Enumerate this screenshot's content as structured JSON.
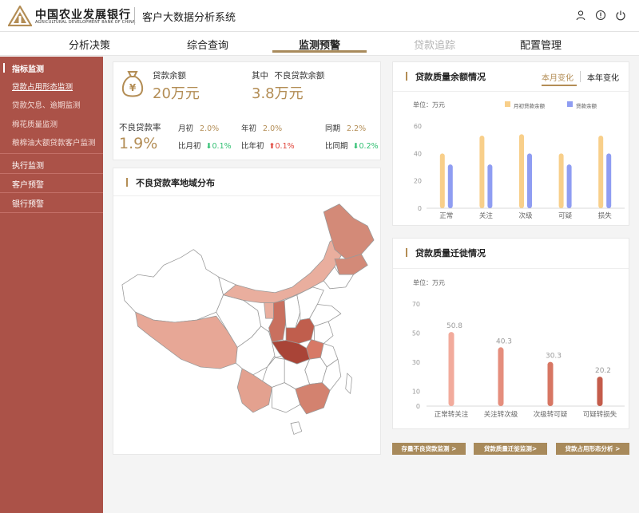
{
  "header": {
    "brand_cn": "中国农业发展银行",
    "brand_en": "AGRICULTURAL DEVELOPMENT BANK OF CHINA",
    "system_title": "客户大数据分析系统",
    "icons": [
      "user-icon",
      "info-icon",
      "power-icon"
    ]
  },
  "nav": {
    "items": [
      {
        "label": "分析决策",
        "state": "normal"
      },
      {
        "label": "综合查询",
        "state": "normal"
      },
      {
        "label": "监测预警",
        "state": "active"
      },
      {
        "label": "贷款追踪",
        "state": "disabled"
      },
      {
        "label": "配置管理",
        "state": "normal"
      }
    ]
  },
  "sidebar": {
    "group_title": "指标监测",
    "items": [
      "贷款占用形态监测",
      "贷款欠息、逾期监测",
      "棉花质量监测",
      "粮棉油大额贷款客户监测"
    ],
    "links": [
      "执行监测",
      "客户预警",
      "银行预警"
    ]
  },
  "summary": {
    "loan_balance_label": "贷款余额",
    "loan_balance_value": "20万元",
    "npl_balance_prefix": "其中",
    "npl_balance_label": "不良贷款余额",
    "npl_balance_value": "3.8万元",
    "npl_rate_label": "不良贷款率",
    "npl_rate_value": "1.9%",
    "month_start_label": "月初",
    "month_start_value": "2.0%",
    "year_start_label": "年初",
    "year_start_value": "2.0%",
    "same_period_label": "同期",
    "same_period_value": "2.2%",
    "vs_month_label": "比月初",
    "vs_month_value": "0.1%",
    "vs_month_dir": "down",
    "vs_year_label": "比年初",
    "vs_year_value": "0.1%",
    "vs_year_dir": "up",
    "vs_same_label": "比同期",
    "vs_same_value": "0.2%",
    "vs_same_dir": "down",
    "colors": {
      "down": "#2fbf71",
      "up": "#e0453b",
      "gold": "#b38d55"
    }
  },
  "map": {
    "title": "不良贷款率地域分布"
  },
  "chart_data": [
    {
      "type": "bar",
      "title": "贷款质量余额情况",
      "tabs": [
        "本月变化",
        "本年变化"
      ],
      "active_tab": "本月变化",
      "unit_label": "单位：万元",
      "categories": [
        "正常",
        "关注",
        "次级",
        "可疑",
        "损失"
      ],
      "series": [
        {
          "name": "月初贷款余额",
          "values": [
            40,
            53,
            54,
            40,
            53
          ],
          "color": "#f8cf8a"
        },
        {
          "name": "贷款余额",
          "values": [
            32,
            32,
            40,
            32,
            40
          ],
          "color": "#8f9df2"
        }
      ],
      "ylim": [
        0,
        60
      ],
      "yticks": [
        0,
        20,
        40,
        60
      ],
      "grid": false,
      "legend": "top-right"
    },
    {
      "type": "bar",
      "title": "贷款质量迁徙情况",
      "unit_label": "单位：万元",
      "categories": [
        "正常转关注",
        "关注转次级",
        "次级转可疑",
        "可疑转损失"
      ],
      "values": [
        50.8,
        40.3,
        30.3,
        20.2
      ],
      "data_labels": [
        "50.8",
        "40.3",
        "30.3",
        "20.2"
      ],
      "colors": [
        "#f2ab9c",
        "#e58e7d",
        "#d77663",
        "#c45c4b"
      ],
      "ylim": [
        0,
        70
      ],
      "yticks": [
        0,
        10,
        30,
        50,
        70
      ],
      "grid": false
    }
  ],
  "buttons": [
    "存量不良贷款监测 >",
    "贷款质量迁徙监测>",
    "贷款占用形态分析 >"
  ]
}
